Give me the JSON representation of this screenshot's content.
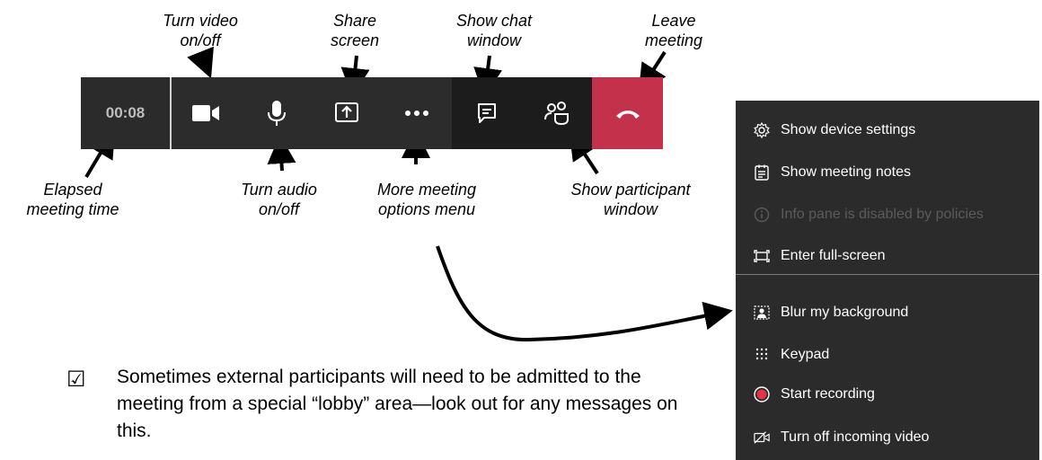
{
  "callouts": {
    "video": "Turn video on/off",
    "share": "Share screen",
    "chat": "Show chat window",
    "leave": "Leave meeting",
    "elapsed": "Elapsed meeting time",
    "audio": "Turn audio on/off",
    "more": "More meeting options menu",
    "participant": "Show participant window"
  },
  "callout_lines": {
    "video": [
      "Turn video",
      "on/off"
    ],
    "share": [
      "Share",
      "screen"
    ],
    "chat": [
      "Show chat",
      "window"
    ],
    "leave": [
      "Leave",
      "meeting"
    ],
    "elapsed": [
      "Elapsed",
      "meeting time"
    ],
    "audio": [
      "Turn audio",
      "on/off"
    ],
    "more": [
      "More meeting",
      "options menu"
    ],
    "participant": [
      "Show participant",
      "window"
    ]
  },
  "toolbar": {
    "timer": "00:08",
    "buttons": [
      {
        "name": "video",
        "icon": "video-camera-icon"
      },
      {
        "name": "audio",
        "icon": "microphone-icon"
      },
      {
        "name": "share",
        "icon": "share-screen-icon"
      },
      {
        "name": "more",
        "icon": "more-options-icon"
      },
      {
        "name": "chat",
        "icon": "chat-icon"
      },
      {
        "name": "participants",
        "icon": "participants-icon"
      },
      {
        "name": "leave",
        "icon": "hang-up-icon"
      }
    ],
    "leave_color": "#c4314b"
  },
  "menu": {
    "items": [
      {
        "label": "Show device settings",
        "icon": "gear-icon"
      },
      {
        "label": "Show meeting notes",
        "icon": "notes-icon"
      },
      {
        "label": "Info pane is disabled by policies",
        "icon": "info-icon",
        "disabled": true
      },
      {
        "label": "Enter full-screen",
        "icon": "fullscreen-icon"
      },
      {
        "label": "Blur my background",
        "icon": "blur-background-icon"
      },
      {
        "label": "Keypad",
        "icon": "keypad-icon"
      },
      {
        "label": "Start recording",
        "icon": "record-icon"
      },
      {
        "label": "Turn off incoming video",
        "icon": "video-off-icon"
      }
    ],
    "record_color": "#e3324a"
  },
  "tip": {
    "checkbox": "☑",
    "text": "Sometimes external participants will need to be admitted to the meeting from a special “lobby” area—look out for any messages on this."
  }
}
